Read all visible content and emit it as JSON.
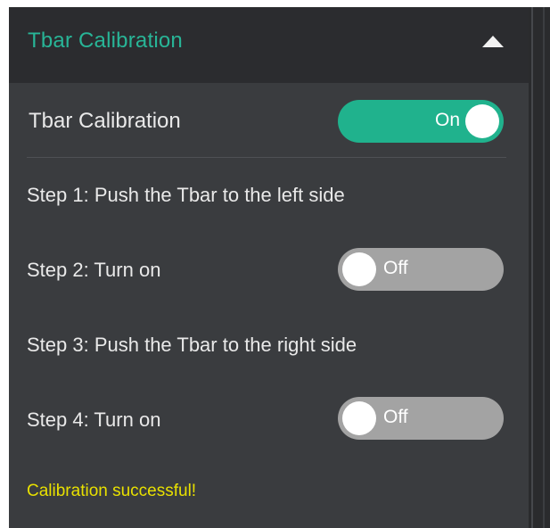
{
  "colors": {
    "accent": "#28b597",
    "toggle_on": "#20b28d",
    "toggle_off": "#a3a3a3",
    "status": "#e8e000",
    "panel_bg": "#3a3c3f",
    "header_bg": "#2b2c2f"
  },
  "section": {
    "title": "Tbar Calibration",
    "caret_icon": "caret-up-icon",
    "expanded": true
  },
  "calibration": {
    "label": "Tbar Calibration",
    "toggle_label": "On",
    "state": true
  },
  "steps": [
    {
      "text": "Step 1: Push the Tbar to the left side"
    },
    {
      "text": "Step 2: Turn on",
      "toggle_label": "Off",
      "state": false
    },
    {
      "text": "Step 3: Push the Tbar to the right side"
    },
    {
      "text": "Step 4: Turn on",
      "toggle_label": "Off",
      "state": false
    }
  ],
  "status": {
    "message": "Calibration successful!"
  }
}
